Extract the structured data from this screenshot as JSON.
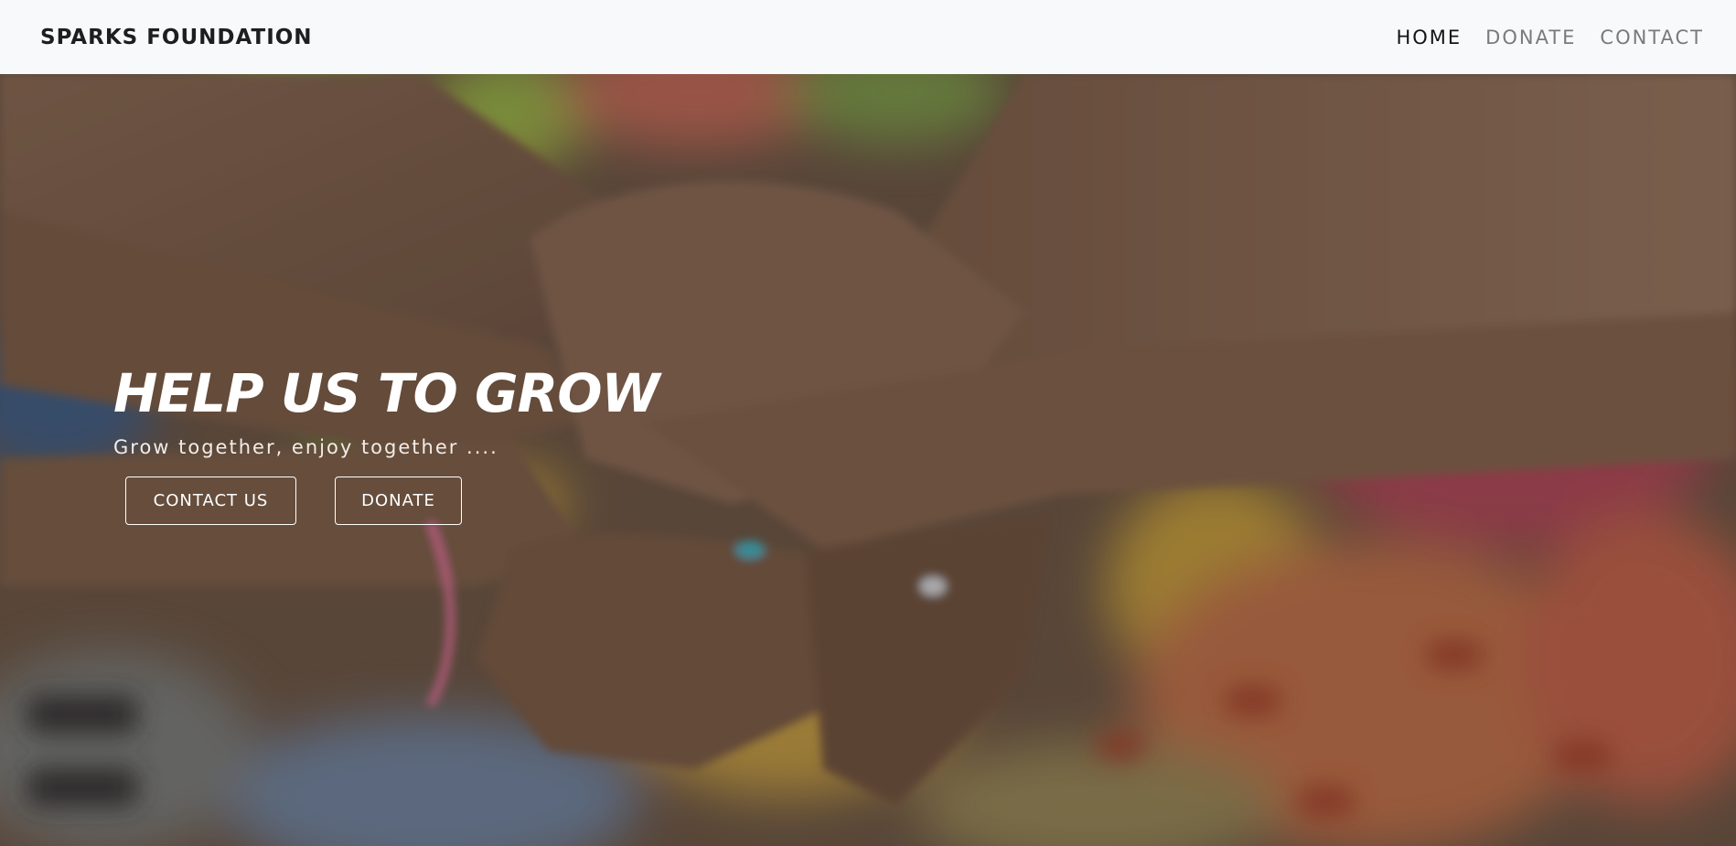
{
  "navbar": {
    "brand": "SPARKS FOUNDATION",
    "links": [
      {
        "label": "HOME",
        "active": true
      },
      {
        "label": "DONATE",
        "active": false
      },
      {
        "label": "CONTACT",
        "active": false
      }
    ]
  },
  "hero": {
    "title": "HELP US TO GROW",
    "subtitle": "Grow together, enjoy together ....",
    "buttons": {
      "contact_label": "CONTACT US",
      "donate_label": "DONATE"
    }
  },
  "colors": {
    "navbar_bg": "#f8f9fa",
    "brand_text": "#1e1e1e",
    "nav_active": "#141414",
    "nav_inactive": "#7a7a7a",
    "hero_text": "#ffffff"
  }
}
